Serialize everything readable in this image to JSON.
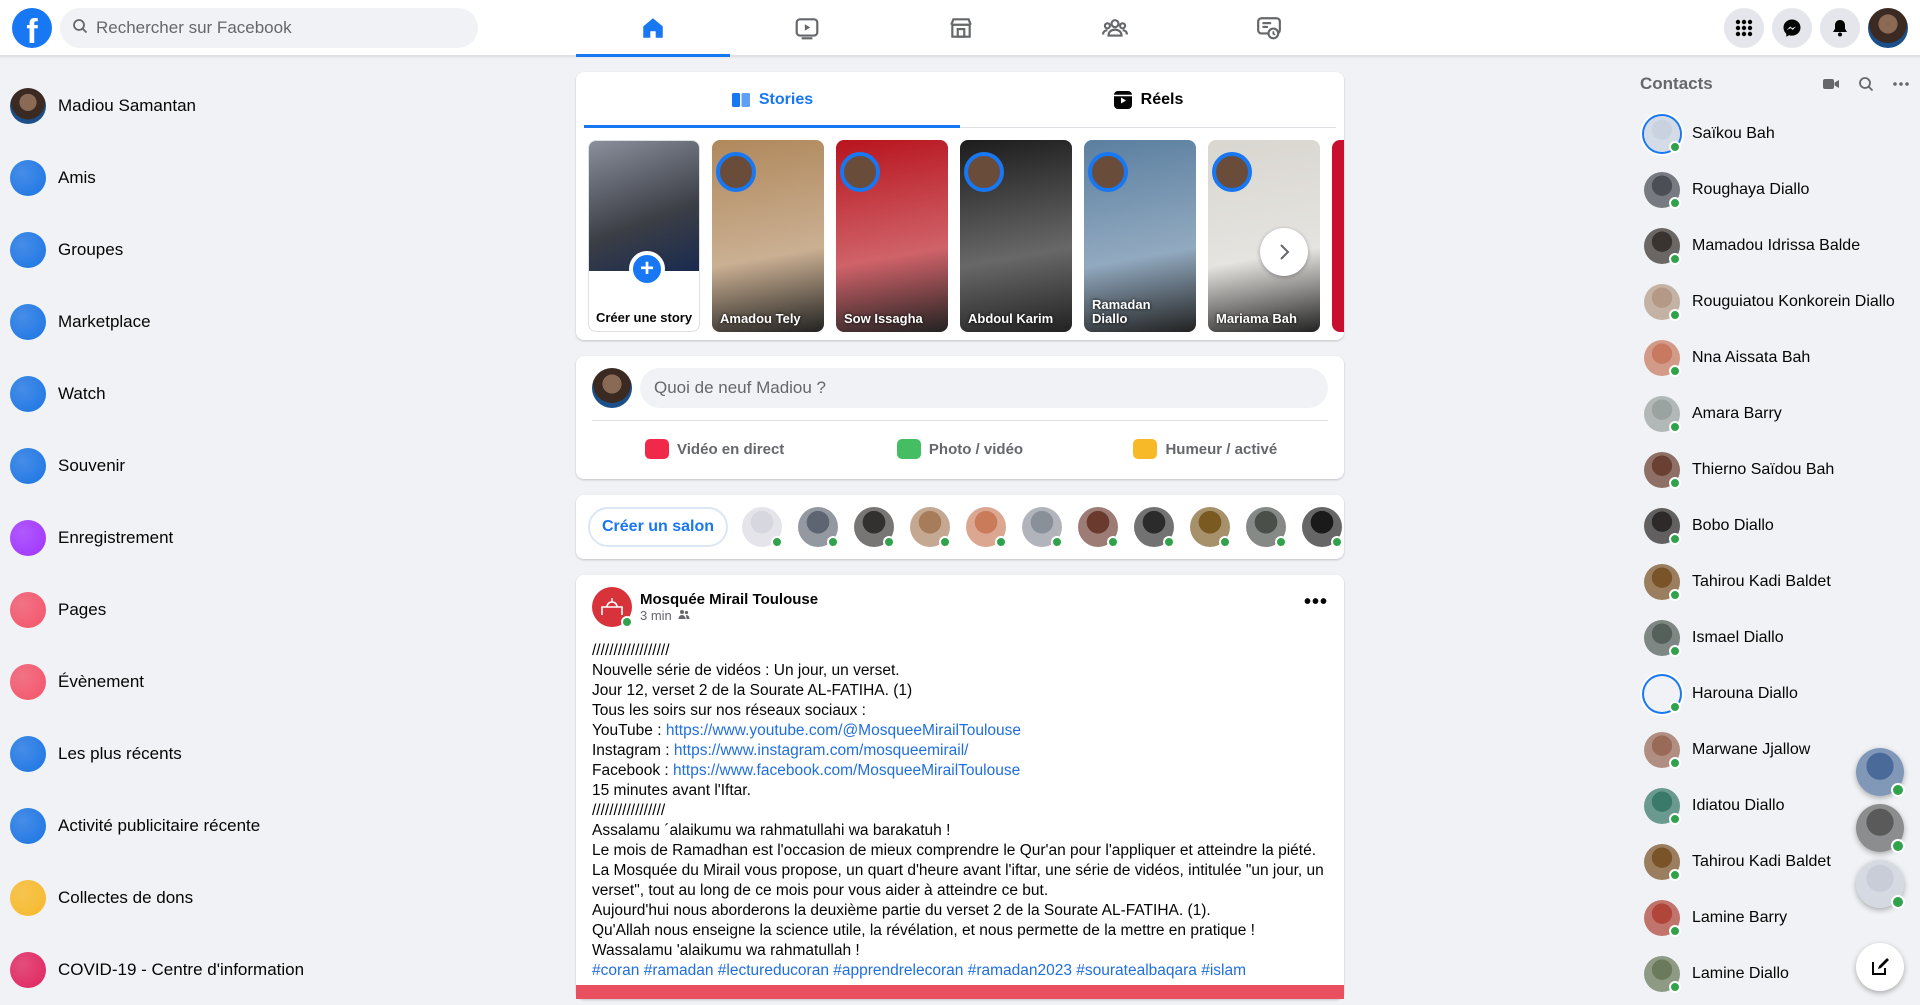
{
  "search": {
    "placeholder": "Rechercher sur Facebook"
  },
  "nav": {
    "tabs": [
      "home-icon",
      "watch-icon",
      "marketplace-icon",
      "groups-icon",
      "gaming-icon"
    ]
  },
  "left": {
    "items": [
      {
        "label": "Madiou Samantan",
        "icon": "avatar",
        "color": "#5a4a3a"
      },
      {
        "label": "Amis",
        "icon": "friends-icon",
        "color": "#1b74e4"
      },
      {
        "label": "Groupes",
        "icon": "groups-icon",
        "color": "#1b74e4"
      },
      {
        "label": "Marketplace",
        "icon": "marketplace-icon",
        "color": "#1b74e4"
      },
      {
        "label": "Watch",
        "icon": "watch-icon",
        "color": "#1b74e4"
      },
      {
        "label": "Souvenir",
        "icon": "memories-icon",
        "color": "#1b74e4"
      },
      {
        "label": "Enregistrement",
        "icon": "saved-icon",
        "color": "#a033ff"
      },
      {
        "label": "Pages",
        "icon": "pages-icon",
        "color": "#f35369"
      },
      {
        "label": "Évènement",
        "icon": "events-icon",
        "color": "#f35369"
      },
      {
        "label": "Les plus récents",
        "icon": "recent-icon",
        "color": "#1b74e4"
      },
      {
        "label": "Activité publicitaire récente",
        "icon": "ads-icon",
        "color": "#1b74e4"
      },
      {
        "label": "Collectes de dons",
        "icon": "fundraisers-icon",
        "color": "#f7b928"
      },
      {
        "label": "COVID-19 - Centre d'information",
        "icon": "covid-icon",
        "color": "#e0245e"
      }
    ]
  },
  "stories_tabs": {
    "stories": "Stories",
    "reels": "Réels"
  },
  "stories": {
    "create_label": "Créer une story",
    "items": [
      {
        "name": "Amadou Tely",
        "bg": "#b0885c"
      },
      {
        "name": "Sow Issagha",
        "bg": "#b8141e"
      },
      {
        "name": "Abdoul Karim",
        "bg": "#1c1c1c"
      },
      {
        "name": "Ramadan Diallo",
        "bg": "#5b7fa0"
      },
      {
        "name": "Mariama Bah",
        "bg": "#d9d6d0"
      }
    ]
  },
  "composer": {
    "placeholder": "Quoi de neuf Madiou ?",
    "actions": [
      {
        "label": "Vidéo en direct",
        "icon": "live-video-icon",
        "color": "#f02849"
      },
      {
        "label": "Photo / vidéo",
        "icon": "photo-icon",
        "color": "#45bd62"
      },
      {
        "label": "Humeur / activé",
        "icon": "feeling-icon",
        "color": "#f7b928"
      }
    ]
  },
  "rooms": {
    "button": "Créer un salon",
    "avatar_colors": [
      "#d7d7df",
      "#5d6472",
      "#33312f",
      "#a67c5a",
      "#c97b5a",
      "#8a9099",
      "#6b3a2e",
      "#2b2b2b",
      "#7a5a20",
      "#4a4f4a",
      "#1a1a1a"
    ]
  },
  "post": {
    "author": "Mosquée Mirail Toulouse",
    "time": "3 min",
    "lines": [
      {
        "t": "//////////////////"
      },
      {
        "t": "Nouvelle série de vidéos : Un jour, un verset."
      },
      {
        "t": "Jour 12, verset 2 de la Sourate AL-FATIHA. (1)"
      },
      {
        "t": "Tous les soirs sur nos réseaux sociaux :"
      },
      {
        "t": "YouTube : ",
        "link": "https://www.youtube.com/@MosqueeMirailToulouse"
      },
      {
        "t": "Instagram : ",
        "link": "https://www.instagram.com/mosqueemirail/"
      },
      {
        "t": "Facebook : ",
        "link": "https://www.facebook.com/MosqueeMirailToulouse"
      },
      {
        "t": "15 minutes avant l'Iftar."
      },
      {
        "t": "/////////////////"
      },
      {
        "t": "Assalamu ´alaikumu wa rahmatullahi wa barakatuh !"
      },
      {
        "t": "Le mois de Ramadhan est l'occasion de mieux comprendre le Qur'an pour l'appliquer et atteindre la piété. La Mosquée du Mirail vous propose, un quart d'heure avant l'iftar, une série de vidéos, intitulée \"un jour, un verset\", tout au long de ce mois pour vous aider à atteindre ce but."
      },
      {
        "t": "Aujourd'hui nous aborderons la deuxième partie du verset 2 de la Sourate AL-FATIHA. (1)."
      },
      {
        "t": "Qu'Allah nous enseigne la science utile, la révélation, et nous permette de la mettre en pratique !"
      },
      {
        "t": "Wassalamu 'alaikumu wa rahmatullah !"
      },
      {
        "t": "",
        "link": "#coran #ramadan #lectureducoran #apprendrelecoran #ramadan2023 #souratealbaqara #islam"
      }
    ]
  },
  "contacts": {
    "title": "Contacts",
    "items": [
      {
        "name": "Saïkou Bah",
        "c": "#c9d3e0",
        "ring": true
      },
      {
        "name": "Roughaya Diallo",
        "c": "#4b4e55"
      },
      {
        "name": "Mamadou Idrissa Balde",
        "c": "#3a3431"
      },
      {
        "name": "Rouguiatou Konkorein Diallo",
        "c": "#b49a86"
      },
      {
        "name": "Nna Aissata Bah",
        "c": "#c87a60"
      },
      {
        "name": "Amara Barry",
        "c": "#9aa3a0"
      },
      {
        "name": "Thierno Saïdou Bah",
        "c": "#6a4032"
      },
      {
        "name": "Bobo Diallo",
        "c": "#2e2a2a"
      },
      {
        "name": "Tahirou Kadi Baldet",
        "c": "#7a5428"
      },
      {
        "name": "Ismael Diallo",
        "c": "#55605a"
      },
      {
        "name": "Harouna Diallo",
        "c": "#222",
        "ring": true
      },
      {
        "name": "Marwane Jjallow",
        "c": "#9a6a58"
      },
      {
        "name": "Idiatou Diallo",
        "c": "#3a7a6a"
      },
      {
        "name": "Tahirou Kadi Baldet",
        "c": "#7a5428"
      },
      {
        "name": "Lamine Barry",
        "c": "#b0463a"
      },
      {
        "name": "Lamine Diallo",
        "c": "#6a7a5a"
      }
    ]
  },
  "floating": {
    "avatars": [
      "#4a6a9a",
      "#5a5a5a",
      "#c8cdd8"
    ]
  }
}
